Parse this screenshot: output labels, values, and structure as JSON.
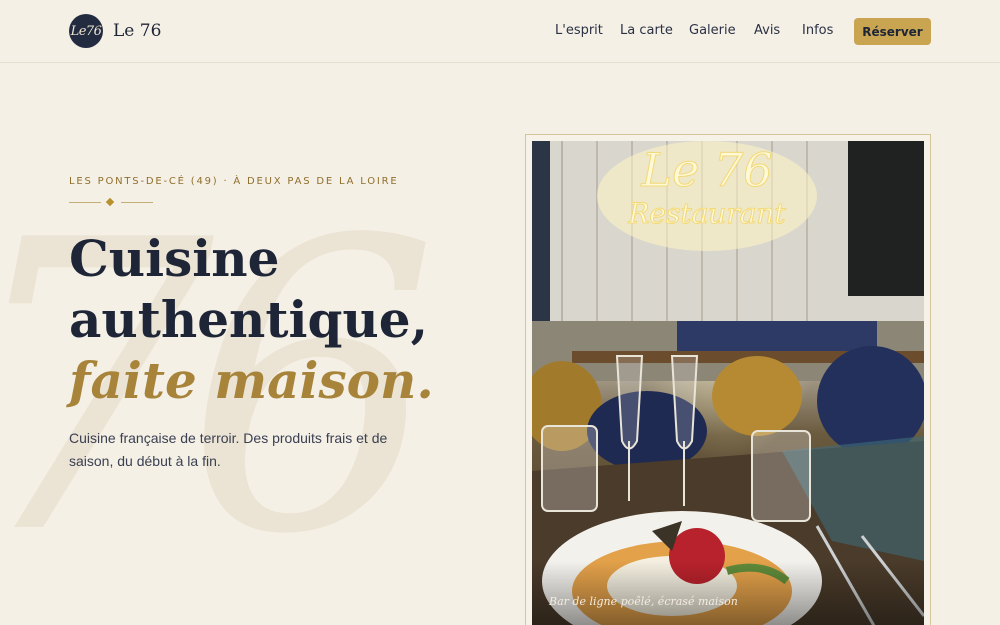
{
  "nav": {
    "logo_badge": "Le76",
    "brand_name": "Le 76",
    "items": [
      "L'esprit",
      "La carte",
      "Galerie",
      "Avis",
      "Infos"
    ],
    "cta": "Réserver"
  },
  "hero": {
    "watermark": "76",
    "eyebrow": "LES PONTS-DE-CÉ (49) · À DEUX PAS DE LA LOIRE",
    "headline_line1": "Cuisine",
    "headline_line2": "authentique,",
    "headline_accent": "faite maison.",
    "lead": "Cuisine française de terroir. Des produits frais et de saison, du début à la fin."
  },
  "photo": {
    "neon_text": "Le 76 Restaurant",
    "caption": "Bar de ligne poêlé, écrasé maison"
  },
  "colors": {
    "background": "#f5f0e6",
    "navy": "#1d2537",
    "gold": "#c9a451",
    "gold_text": "#a8843b"
  }
}
